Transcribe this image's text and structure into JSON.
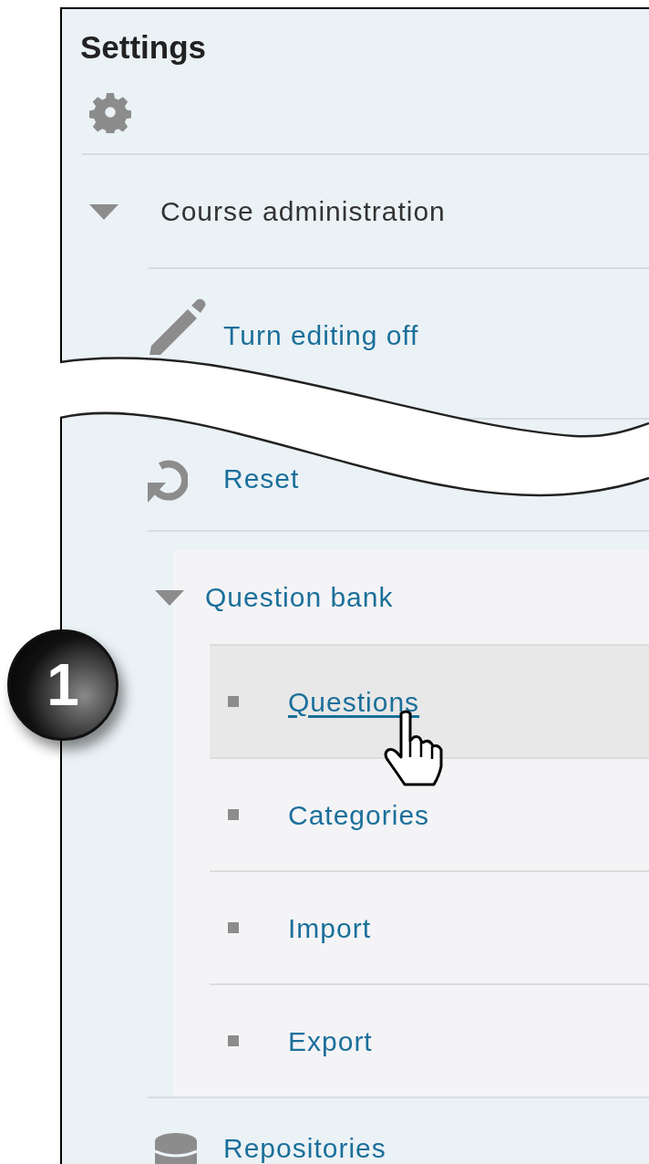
{
  "panel": {
    "title": "Settings"
  },
  "tree": [
    {
      "label": "Course administration",
      "expanded": true,
      "children": [
        {
          "label": "Turn editing off",
          "kind": "edit"
        },
        {
          "label": "Reset",
          "kind": "reset"
        },
        {
          "label": "Question bank",
          "kind": "folder",
          "expanded": true,
          "children": [
            {
              "label": "Questions",
              "selected": true
            },
            {
              "label": "Categories",
              "selected": false
            },
            {
              "label": "Import",
              "selected": false
            },
            {
              "label": "Export",
              "selected": false
            }
          ]
        },
        {
          "label": "Repositories",
          "kind": "repository"
        }
      ]
    }
  ],
  "callout": {
    "number": "1"
  }
}
